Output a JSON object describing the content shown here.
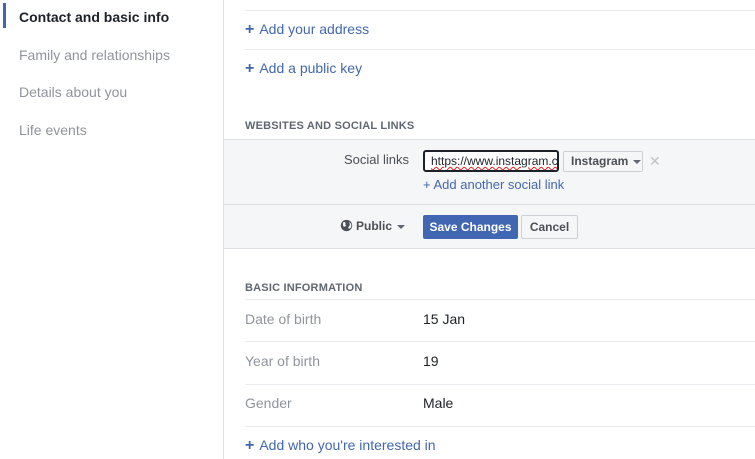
{
  "sidebar": {
    "items": [
      {
        "label": "Contact and basic info",
        "active": true
      },
      {
        "label": "Family and relationships",
        "active": false
      },
      {
        "label": "Details about you",
        "active": false
      },
      {
        "label": "Life events",
        "active": false
      }
    ]
  },
  "contact": {
    "add_address": "Add your address",
    "add_public_key": "Add a public key"
  },
  "websites": {
    "header": "WEBSITES AND SOCIAL LINKS",
    "social_links_label": "Social links",
    "url_value": "https://www.instagram.co",
    "network_selected": "Instagram",
    "remove_symbol": "✕",
    "add_another": "+ Add another social link",
    "privacy_label": "Public",
    "save_label": "Save Changes",
    "cancel_label": "Cancel"
  },
  "basic_info": {
    "header": "BASIC INFORMATION",
    "rows": [
      {
        "label": "Date of birth",
        "value": "15 Jan"
      },
      {
        "label": "Year of birth",
        "value": "19"
      },
      {
        "label": "Gender",
        "value": "Male"
      }
    ],
    "add_interested": "Add who you're interested in"
  },
  "colors": {
    "accent": "#4267b2",
    "muted_text": "#90949c",
    "panel_bg": "#f5f6f7"
  },
  "icons": {
    "plus": "plus-icon",
    "globe": "globe-icon",
    "caret": "caret-down-icon",
    "remove": "close-icon"
  }
}
